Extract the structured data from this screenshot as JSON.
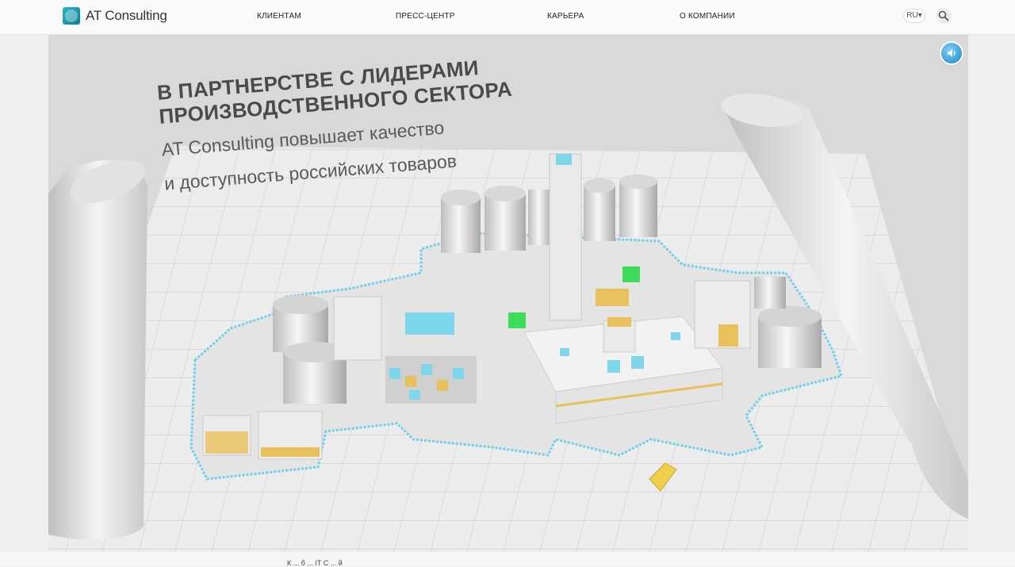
{
  "header": {
    "logo_text": "AT Consulting",
    "nav": [
      "КЛИЕНТАМ",
      "ПРЕСС-ЦЕНТР",
      "КАРЬЕРА",
      "О КОМПАНИИ"
    ],
    "lang": "RU▾"
  },
  "hero": {
    "title_line1": "В ПАРТНЕРСТВЕ С ЛИДЕРАМИ",
    "title_line2": "ПРОИЗВОДСТВЕННОГО СЕКТОРА",
    "subtitle_line1": "AT Consulting повышает качество",
    "subtitle_line2": "и доступность российских товаров"
  },
  "footer": {
    "text": "К ... б ... IT С ... й"
  },
  "colors": {
    "accent": "#1a9fc0",
    "cyan_parts": "#7ed6ea",
    "yellow_parts": "#e8c15a",
    "green_parts": "#3ddc5a"
  },
  "icons": [
    "logo-icon",
    "search-icon",
    "sound-icon"
  ]
}
